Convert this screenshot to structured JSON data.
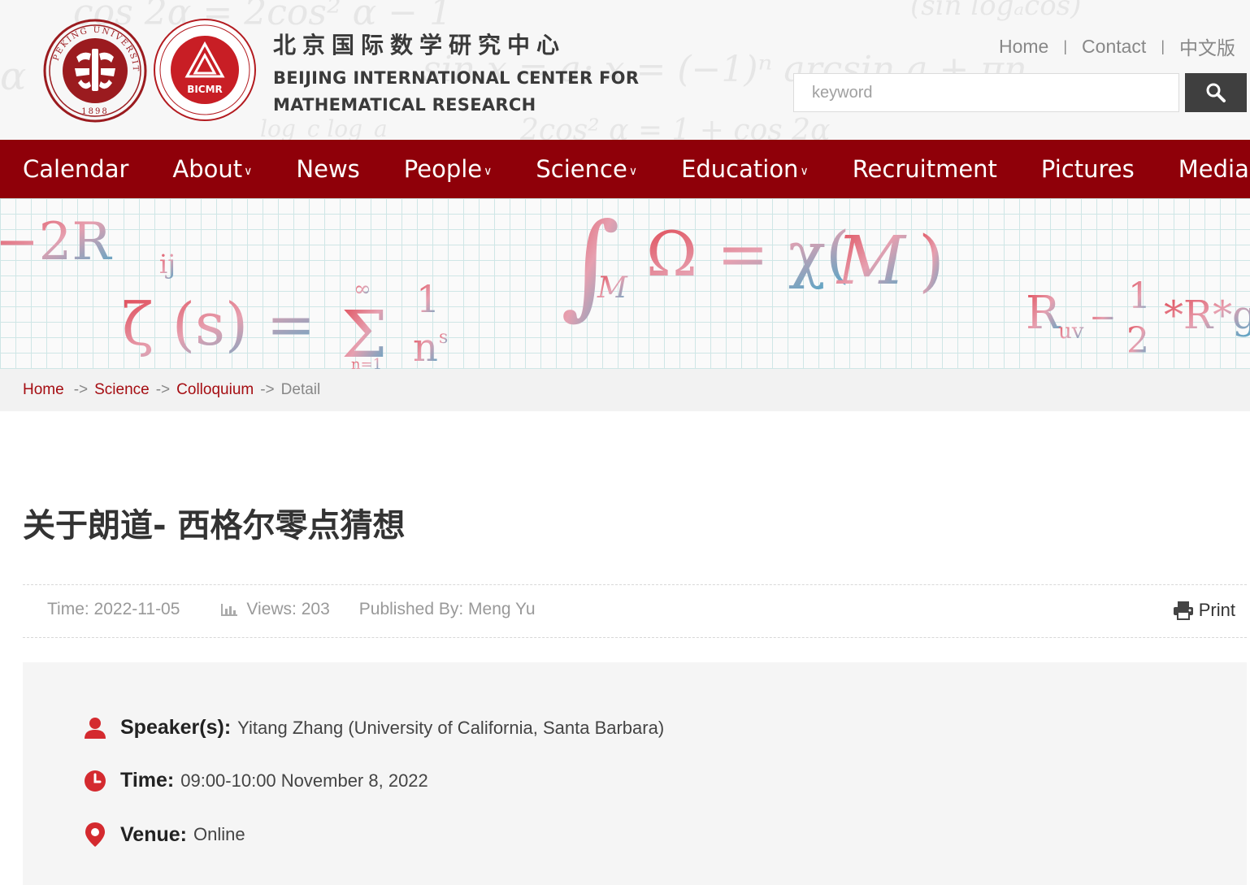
{
  "header": {
    "org_cn": "北京国际数学研究中心",
    "org_en_line1": "BEIJING INTERNATIONAL CENTER FOR",
    "org_en_line2": "MATHEMATICAL RESEARCH",
    "pku_seal_text": "PEKING UNIVERSITY",
    "pku_seal_year": "1898",
    "bicmr_logo_text": "BICMR",
    "top_links": [
      "Home",
      "Contact",
      "中文版"
    ],
    "search_placeholder": "keyword"
  },
  "nav": {
    "items": [
      {
        "label": "Calendar",
        "dropdown": false
      },
      {
        "label": "About",
        "dropdown": true
      },
      {
        "label": "News",
        "dropdown": false
      },
      {
        "label": "People",
        "dropdown": true
      },
      {
        "label": "Science",
        "dropdown": true
      },
      {
        "label": "Education",
        "dropdown": true
      },
      {
        "label": "Recruitment",
        "dropdown": false
      },
      {
        "label": "Pictures",
        "dropdown": false
      },
      {
        "label": "Media",
        "dropdown": false
      }
    ]
  },
  "breadcrumb": {
    "home": "Home",
    "science": "Science",
    "colloquium": "Colloquium",
    "current": "Detail",
    "arrow": "->"
  },
  "article": {
    "title": "关于朗道- 西格尔零点猜想",
    "time": "Time: 2022-11-05",
    "views": "Views: 203",
    "published_by": "Published By: Meng Yu",
    "print": "Print"
  },
  "info": {
    "speaker_label": "Speaker(s):",
    "speaker_value": "Yitang Zhang (University of California, Santa Barbara)",
    "time_label": "Time:",
    "time_value": "09:00-10:00 November 8, 2022",
    "venue_label": "Venue:",
    "venue_value": "Online"
  },
  "colors": {
    "brand_red": "#8f0009",
    "link_red": "#a50d12",
    "icon_red": "#d42a2f",
    "search_button": "#3f3f3f"
  },
  "icons": [
    "search-icon",
    "chevron-down-icon",
    "bar-chart-icon",
    "printer-icon",
    "person-icon",
    "clock-icon",
    "location-pin-icon"
  ]
}
